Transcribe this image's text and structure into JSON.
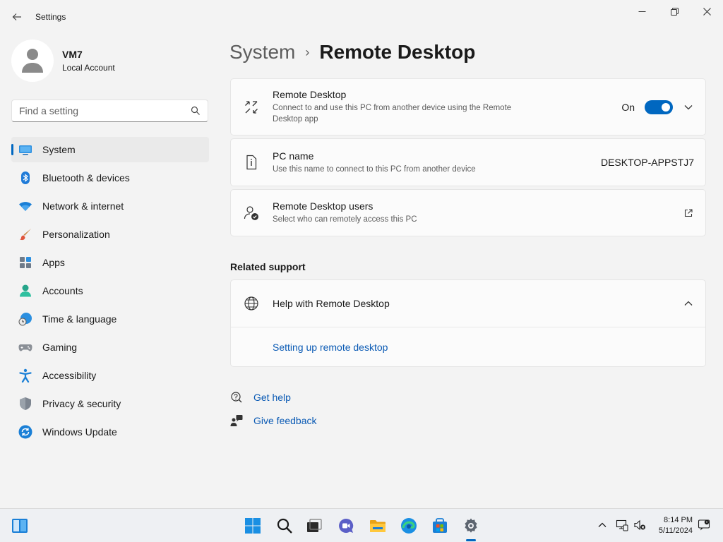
{
  "window": {
    "title": "Settings"
  },
  "profile": {
    "name": "VM7",
    "account_type": "Local Account"
  },
  "search": {
    "placeholder": "Find a setting"
  },
  "nav": [
    {
      "label": "System",
      "icon": "system-icon",
      "active": true
    },
    {
      "label": "Bluetooth & devices",
      "icon": "bluetooth-icon"
    },
    {
      "label": "Network & internet",
      "icon": "wifi-icon"
    },
    {
      "label": "Personalization",
      "icon": "brush-icon"
    },
    {
      "label": "Apps",
      "icon": "apps-icon"
    },
    {
      "label": "Accounts",
      "icon": "accounts-icon"
    },
    {
      "label": "Time & language",
      "icon": "clock-globe-icon"
    },
    {
      "label": "Gaming",
      "icon": "gamepad-icon"
    },
    {
      "label": "Accessibility",
      "icon": "accessibility-icon"
    },
    {
      "label": "Privacy & security",
      "icon": "shield-icon"
    },
    {
      "label": "Windows Update",
      "icon": "update-icon"
    }
  ],
  "breadcrumb": {
    "parent": "System",
    "separator": "›",
    "current": "Remote Desktop"
  },
  "remote_desktop": {
    "title": "Remote Desktop",
    "description": "Connect to and use this PC from another device using the Remote Desktop app",
    "toggle_label": "On",
    "enabled": true
  },
  "pc_name": {
    "title": "PC name",
    "description": "Use this name to connect to this PC from another device",
    "value": "DESKTOP-APPSTJ7"
  },
  "rd_users": {
    "title": "Remote Desktop users",
    "description": "Select who can remotely access this PC"
  },
  "related_support": {
    "heading": "Related support",
    "help_title": "Help with Remote Desktop",
    "link": "Setting up remote desktop"
  },
  "support_links": {
    "get_help": "Get help",
    "feedback": "Give feedback"
  },
  "taskbar": {
    "time": "8:14 PM",
    "date": "5/11/2024"
  },
  "colors": {
    "accent": "#0067c0",
    "link": "#0a5ab4",
    "background": "#f3f3f3"
  }
}
